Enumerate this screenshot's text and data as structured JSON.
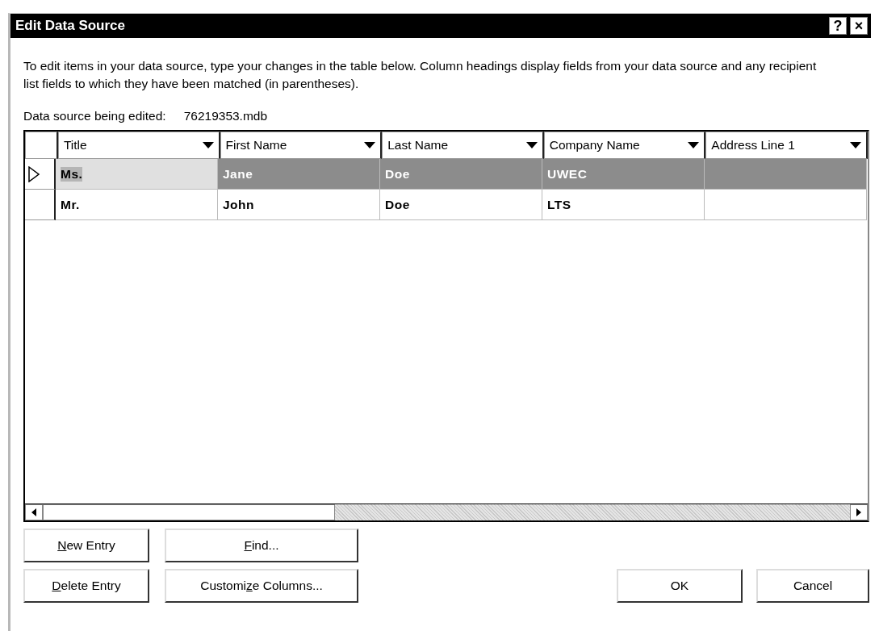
{
  "window": {
    "title": "Edit Data Source",
    "help_button": "?",
    "close_button": "×"
  },
  "instructions": "To edit items in your data source, type your changes in the table below. Column headings display fields from your data source and any recipient list fields to which they have been matched (in parentheses).",
  "source": {
    "label": "Data source being edited:",
    "value": "76219353.mdb"
  },
  "table": {
    "columns": [
      "Title",
      "First Name",
      "Last Name",
      "Company Name",
      "Address Line 1"
    ],
    "rows": [
      {
        "selected": true,
        "cells": [
          "Ms.",
          "Jane",
          "Doe",
          "UWEC",
          ""
        ]
      },
      {
        "selected": false,
        "cells": [
          "Mr.",
          "John",
          "Doe",
          "LTS",
          ""
        ]
      }
    ]
  },
  "buttons_left": [
    [
      {
        "access_key": "N",
        "label_rest": "ew Entry"
      },
      {
        "access_key": "F",
        "label_rest": "ind..."
      }
    ],
    [
      {
        "access_key": "D",
        "label_rest": "elete Entry"
      },
      {
        "label_start": "Customi",
        "access_key": "z",
        "label_rest": "e Columns..."
      }
    ]
  ],
  "buttons_right": [
    "OK",
    "Cancel"
  ]
}
